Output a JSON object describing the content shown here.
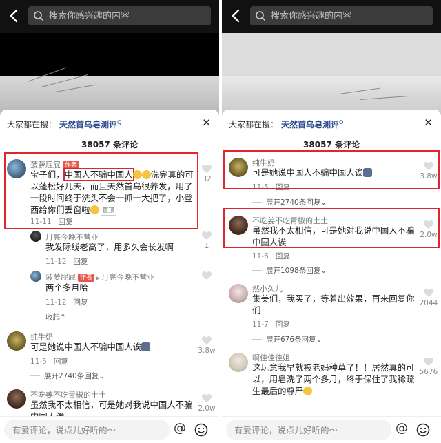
{
  "search_placeholder": "搜索你感兴趣的内容",
  "hot_search": {
    "label": "大家都在搜：",
    "keyword": "天然首乌皂测评",
    "mark": "Q"
  },
  "comment_count": "38057 条评论",
  "bottom": {
    "placeholder": "有爱评论，说点儿好听的～",
    "at_symbol": "@"
  },
  "left": {
    "main": {
      "user": "菠萝屁屁",
      "author_badge": "作者",
      "text_line1_a": "宝子们，",
      "text_line1_b": "中国人不骗中国人",
      "text_line1_c": "洗完真的",
      "text_rest": "可以蓬松好几天，而且天然首乌很养发，用了一段时间终于洗头不会一抓一大把了，小登西给你们丢窗啦",
      "pin": "置顶",
      "date": "11-11",
      "reply": "回复",
      "likes": "32"
    },
    "sub1": {
      "user": "月亮今晚不营业",
      "text": "我发际线老高了，用多久会长发啊",
      "date": "11-12",
      "reply": "回复",
      "likes": "1"
    },
    "sub2": {
      "user": "菠萝屁屁",
      "author_badge": "作者",
      "reply_to": "月亮今晚不营业",
      "text": "两个多月哈",
      "date": "11-12",
      "reply": "回复"
    },
    "collapse": "收起",
    "c3": {
      "user": "纯牛奶",
      "text": "可是她说中国人不骗中国人诶",
      "date": "11-5",
      "reply": "回复",
      "likes": "3.8w"
    },
    "c3_expand": "展开2740条回复",
    "c4": {
      "user": "不吃姜不吃青椒的土土",
      "text": "虽然我不太相信，可是她对我说中国人不骗中国人诶",
      "likes": "2.0w"
    }
  },
  "right": {
    "c1": {
      "user": "纯牛奶",
      "text": "可是她说中国人不骗中国人诶",
      "date": "11-5",
      "reply": "回复",
      "likes": "3.8w"
    },
    "c1_expand": "展开2740条回复",
    "c2": {
      "user": "不吃姜不吃青椒的土土",
      "text": "虽然我不太相信，可是她对我说中国人不骗中国人诶",
      "date": "11-6",
      "reply": "回复",
      "likes": "2.0w"
    },
    "c2_expand": "展开1098条回复",
    "c3": {
      "user": "然小久儿",
      "text": "集美们，我买了，等着出效果，再来回复你们",
      "date": "11-7",
      "reply": "回复",
      "likes": "2044"
    },
    "c3_expand": "展开676条回复",
    "c4": {
      "user": "啊佳佳佳姐",
      "text": "这玩意我早就被老妈种草了！！居然真的可以，用皂洗了两个多月，终于保住了我稀疏生最后的尊严",
      "likes": "5676"
    }
  },
  "colors": {
    "highlight_box": "#e0262d",
    "author_badge": "#e8564a",
    "keyword": "#2a4d8f"
  },
  "icons": [
    "back-icon",
    "search-icon",
    "close-icon",
    "heart-icon",
    "at-icon",
    "smile-icon",
    "chevron-down-icon",
    "chevron-up-icon"
  ]
}
